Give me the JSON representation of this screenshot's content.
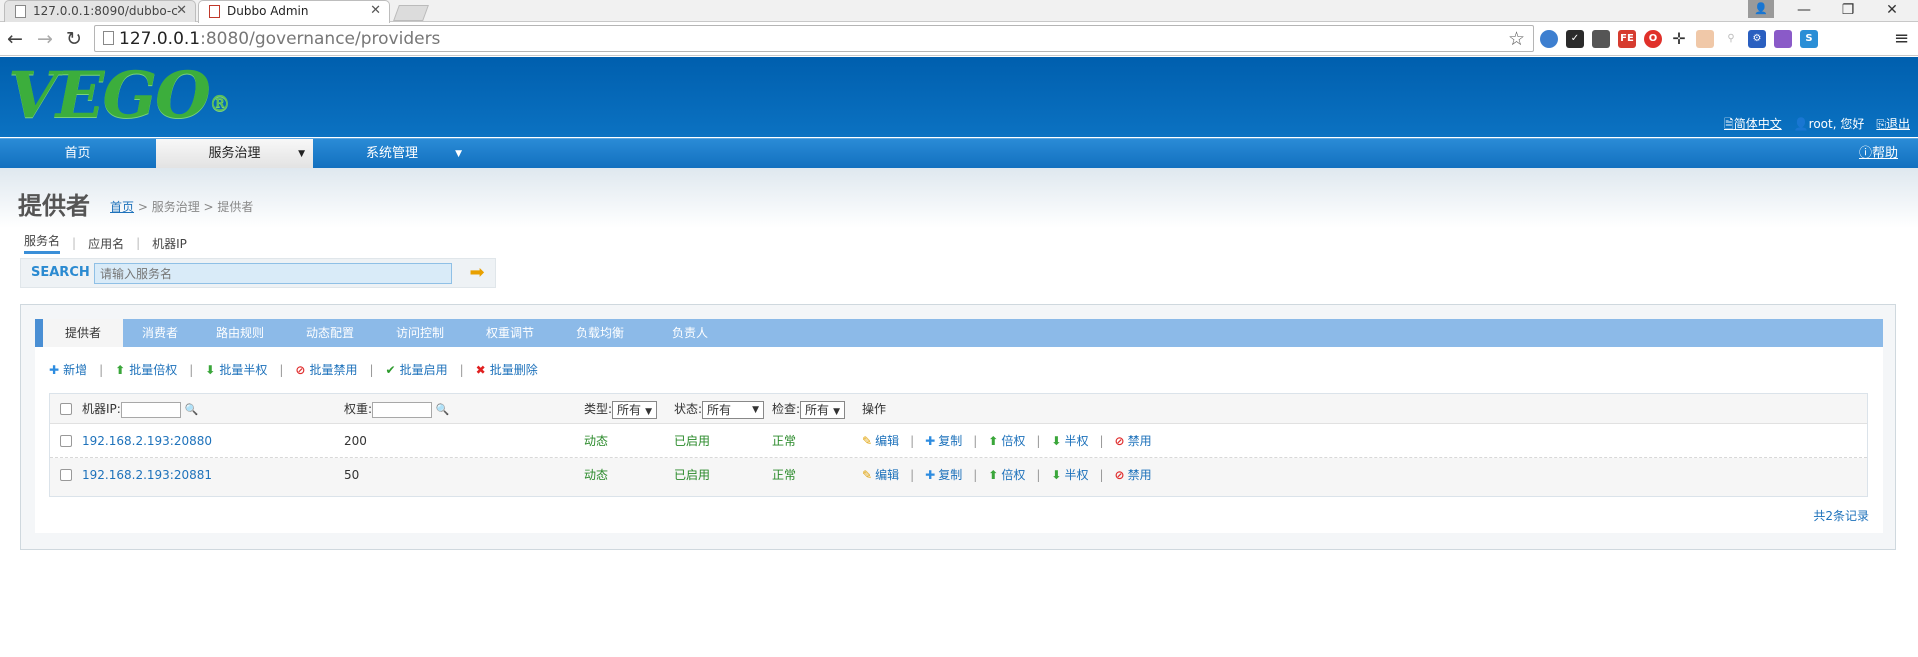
{
  "browser": {
    "tabs": [
      {
        "title": "127.0.0.1:8090/dubbo-c",
        "active": false
      },
      {
        "title": "Dubbo Admin",
        "active": true
      }
    ],
    "url_host": "127.0.0.1",
    "url_rest": ":8080/governance/providers"
  },
  "app": {
    "logo": "VEGO",
    "logo_mark": "®",
    "header_links": {
      "language": "简体中文",
      "user": "root, 您好",
      "logout": "退出"
    },
    "menu": [
      {
        "label": "首页"
      },
      {
        "label": "服务治理"
      },
      {
        "label": "系统管理"
      }
    ],
    "help": "帮助"
  },
  "page": {
    "title": "提供者",
    "breadcrumb": {
      "home": "首页",
      "rest": " > 服务治理 > 提供者"
    },
    "search_tabs": [
      "服务名",
      "应用名",
      "机器IP"
    ],
    "search_label": "SEARCH",
    "search_placeholder": "请输入服务名"
  },
  "panel": {
    "tabs": [
      "提供者",
      "消费者",
      "路由规则",
      "动态配置",
      "访问控制",
      "权重调节",
      "负载均衡",
      "负责人"
    ],
    "toolbar": [
      "新增",
      "批量倍权",
      "批量半权",
      "批量禁用",
      "批量启用",
      "批量删除"
    ],
    "table": {
      "headers": {
        "ip": "机器IP:",
        "weight": "权重:",
        "type": "类型:",
        "status": "状态:",
        "check": "检查:",
        "ops": "操作"
      },
      "filter_all": "所有",
      "rows": [
        {
          "ip": "192.168.2.193:20880",
          "weight": "200",
          "type": "动态",
          "status": "已启用",
          "check": "正常"
        },
        {
          "ip": "192.168.2.193:20881",
          "weight": "50",
          "type": "动态",
          "status": "已启用",
          "check": "正常"
        }
      ],
      "ops": [
        "编辑",
        "复制",
        "倍权",
        "半权",
        "禁用"
      ]
    },
    "total": "共2条记录"
  },
  "colors": {
    "header": "#005fae",
    "menu": "#1270bf",
    "link": "#1e72bb",
    "green": "#2a8a2a"
  }
}
